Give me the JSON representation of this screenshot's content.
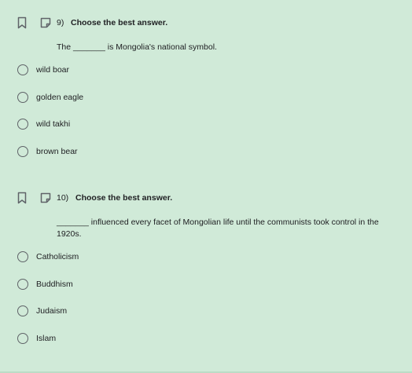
{
  "questions": [
    {
      "number": "9)",
      "instruction": "Choose the best answer.",
      "prompt": "The _______ is Mongolia's national symbol.",
      "choices": [
        {
          "label": "wild boar"
        },
        {
          "label": "golden eagle"
        },
        {
          "label": "wild takhi"
        },
        {
          "label": "brown bear"
        }
      ]
    },
    {
      "number": "10)",
      "instruction": "Choose the best answer.",
      "prompt": "_______ influenced every facet of Mongolian life until the communists took control in the 1920s.",
      "choices": [
        {
          "label": "Catholicism"
        },
        {
          "label": "Buddhism"
        },
        {
          "label": "Judaism"
        },
        {
          "label": "Islam"
        }
      ]
    }
  ],
  "icons": {
    "bookmark": "bookmark-icon",
    "note": "note-icon"
  },
  "colors": {
    "background": "#d0ead8",
    "text": "#202124",
    "radio_border": "#5f6368"
  }
}
